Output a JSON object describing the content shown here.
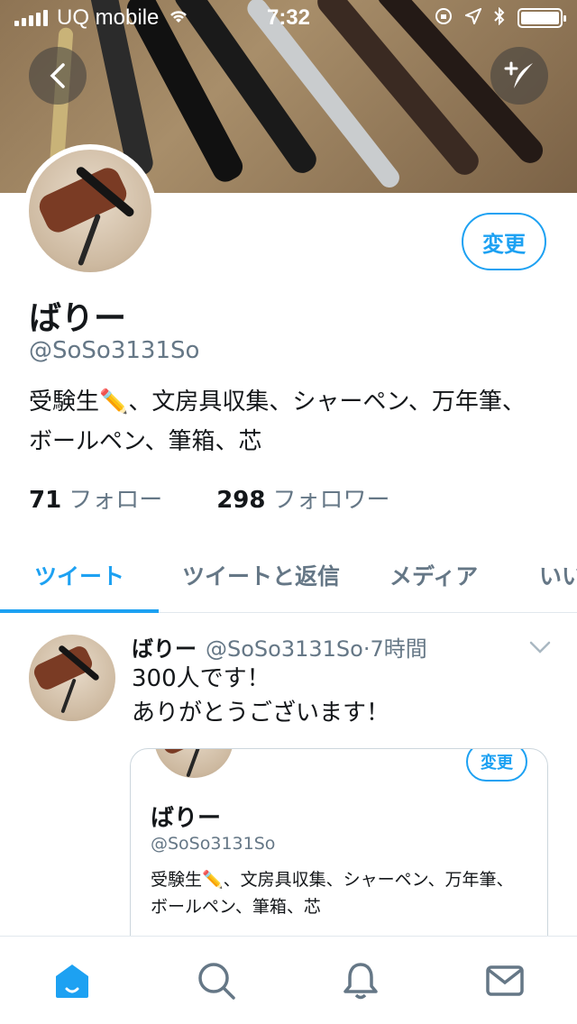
{
  "status_bar": {
    "carrier": "UQ mobile",
    "time": "7:32"
  },
  "profile": {
    "name": "ばりー",
    "handle": "@SoSo3131So",
    "bio": "受験生✏️、文房具収集、シャーペン、万年筆、ボールペン、筆箱、芯",
    "edit_label": "変更",
    "following_count": "71",
    "following_label": "フォロー",
    "followers_count": "298",
    "followers_label": "フォロワー"
  },
  "tabs": [
    {
      "label": "ツイート",
      "active": true
    },
    {
      "label": "ツイートと返信",
      "active": false
    },
    {
      "label": "メディア",
      "active": false
    },
    {
      "label": "いい",
      "active": false
    }
  ],
  "tweet": {
    "author_name": "ばりー",
    "author_handle": "@SoSo3131So",
    "separator": "·",
    "time": "7時間",
    "text_line1": "300人です！",
    "text_line2": "ありがとうございます！",
    "card": {
      "name": "ばりー",
      "handle": "@SoSo3131So",
      "bio": "受験生✏️、文房具収集、シャーペン、万年筆、ボールペン、筆箱、芯",
      "edit_label": "変更"
    }
  },
  "bottom_nav": [
    "home-icon",
    "search-icon",
    "notifications-icon",
    "messages-icon"
  ],
  "colors": {
    "accent": "#1da1f2",
    "secondary_text": "#657786"
  }
}
